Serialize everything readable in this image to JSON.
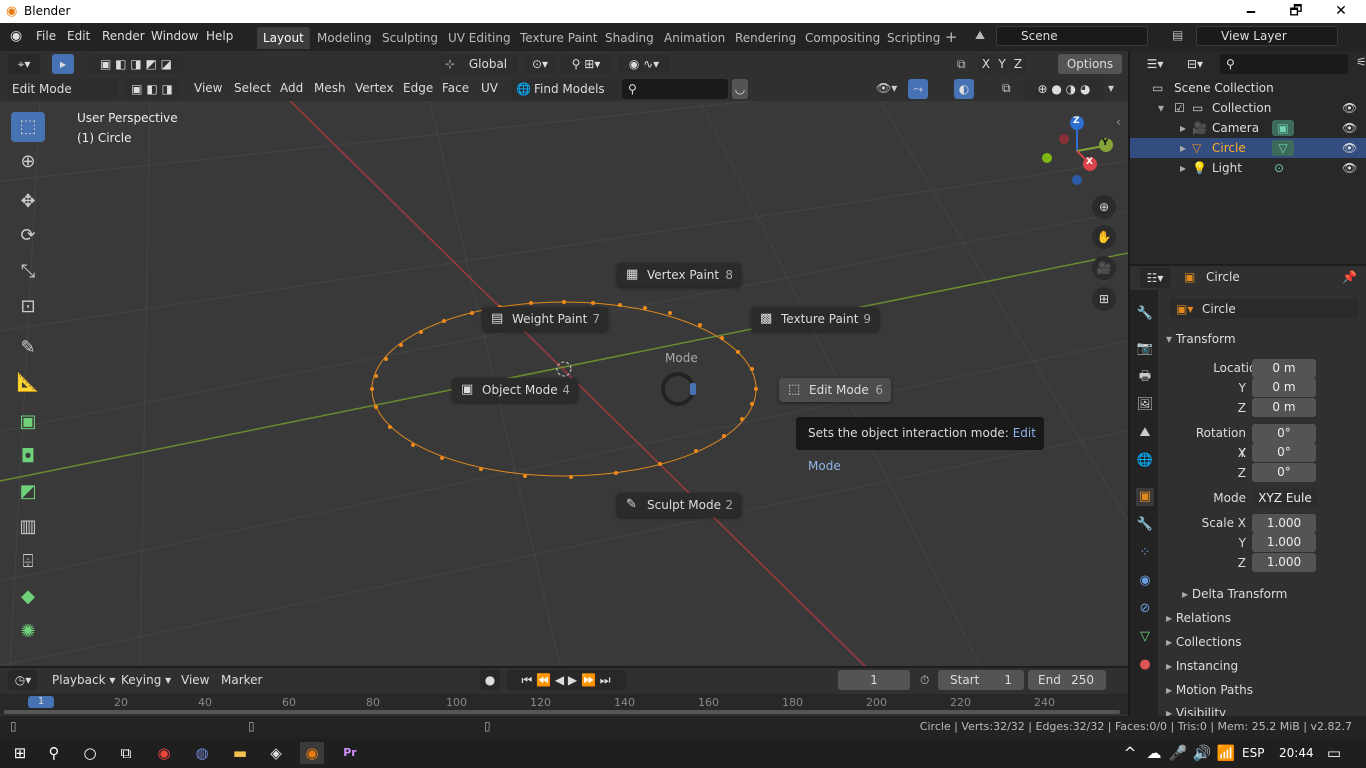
{
  "window": {
    "title": "Blender",
    "minimize": "🗕",
    "restore": "🗗",
    "close": "✕"
  },
  "menu": {
    "items": [
      "File",
      "Edit",
      "Render",
      "Window",
      "Help"
    ]
  },
  "workspaces": [
    "Layout",
    "Modeling",
    "Sculpting",
    "UV Editing",
    "Texture Paint",
    "Shading",
    "Animation",
    "Rendering",
    "Compositing",
    "Scripting"
  ],
  "scene": {
    "value": "Scene",
    "view_layer": "View Layer"
  },
  "toolheader": {
    "orientation": "Global",
    "options": "Options",
    "axes": [
      "X",
      "Y",
      "Z"
    ]
  },
  "viewport_header": {
    "mode": "Edit Mode",
    "menus": [
      "View",
      "Select",
      "Add",
      "Mesh",
      "Vertex",
      "Edge",
      "Face",
      "UV"
    ],
    "find_models": "Find Models"
  },
  "viewport": {
    "perspective": "User Perspective",
    "object": "(1) Circle"
  },
  "pie_menu": {
    "title": "Mode",
    "items": [
      {
        "label": "Vertex Paint",
        "key": "8"
      },
      {
        "label": "Weight Paint",
        "key": "7"
      },
      {
        "label": "Texture Paint",
        "key": "9"
      },
      {
        "label": "Object Mode",
        "key": "4"
      },
      {
        "label": "Edit Mode",
        "key": "6"
      },
      {
        "label": "Sculpt Mode",
        "key": "2"
      }
    ],
    "tooltip_prefix": "Sets the object interaction mode:",
    "tooltip_value": "Edit Mode"
  },
  "gizmo": {
    "z": "Z",
    "y": "Y",
    "x": "X"
  },
  "outliner": {
    "root": "Scene Collection",
    "collection": "Collection",
    "items": [
      "Camera",
      "Circle",
      "Light"
    ]
  },
  "properties": {
    "object_name": "Circle",
    "object_field": "Circle",
    "transform": "Transform",
    "location_label": "Location X",
    "y_label": "Y",
    "z_label": "Z",
    "location": [
      "0 m",
      "0 m",
      "0 m"
    ],
    "rotation_label": "Rotation X",
    "rotation": [
      "0°",
      "0°",
      "0°"
    ],
    "mode_label": "Mode",
    "mode_value": "XYZ Eule",
    "scale_label": "Scale X",
    "scale": [
      "1.000",
      "1.000",
      "1.000"
    ],
    "delta": "Delta Transform",
    "sections": [
      "Relations",
      "Collections",
      "Instancing",
      "Motion Paths",
      "Visibility"
    ]
  },
  "timeline": {
    "menus": [
      "Playback",
      "Keying",
      "View",
      "Marker"
    ],
    "frame": "1",
    "start_label": "Start",
    "start": "1",
    "end_label": "End",
    "end": "250",
    "ticks": [
      "1",
      "20",
      "40",
      "60",
      "80",
      "100",
      "120",
      "140",
      "160",
      "180",
      "200",
      "220",
      "240"
    ]
  },
  "status": {
    "text": "Circle | Verts:32/32 | Edges:32/32 | Faces:0/0 | Tris:0 | Mem: 25.2 MiB | v2.82.7"
  },
  "taskbar": {
    "lang": "ESP",
    "time": "20:44"
  },
  "colors": {
    "accent": "#4772b3",
    "x_axis": "#cc4444",
    "y_axis": "#86a33a",
    "selection": "#e08a1e"
  }
}
